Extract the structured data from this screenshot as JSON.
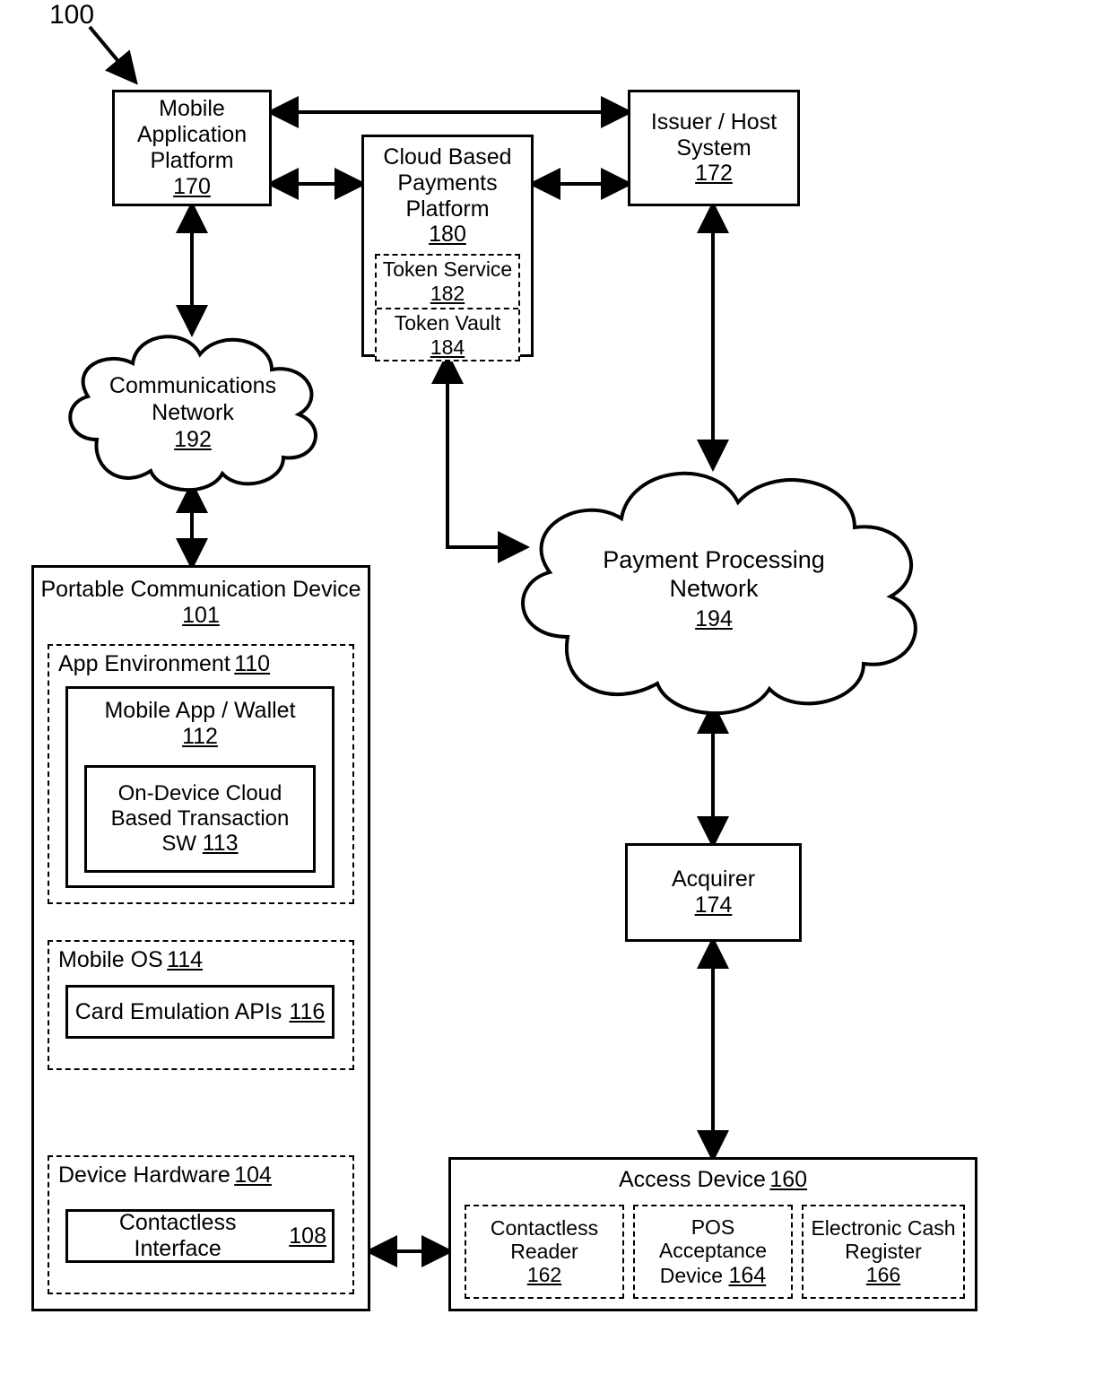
{
  "figure_ref": "100",
  "nodes": {
    "map": {
      "label": "Mobile Application Platform",
      "num": "170"
    },
    "cbpp": {
      "label": "Cloud Based Payments Platform",
      "num": "180"
    },
    "tsvc": {
      "label_a": "Token Service",
      "num_a": "182",
      "label_b": "Token Vault",
      "num_b": "184"
    },
    "issuer": {
      "label": "Issuer / Host System",
      "num": "172"
    },
    "comm": {
      "label": "Communications Network",
      "num": "192"
    },
    "ppn": {
      "label": "Payment Processing Network",
      "num": "194"
    },
    "acq": {
      "label": "Acquirer",
      "num": "174"
    },
    "pcd": {
      "label": "Portable Communication Device",
      "num": "101"
    },
    "appenv": {
      "label": "App Environment",
      "num": "110"
    },
    "wallet": {
      "label": "Mobile App / Wallet",
      "num": "112"
    },
    "odcbt": {
      "label": "On-Device Cloud Based Transaction SW",
      "num": "113"
    },
    "mos": {
      "label": "Mobile OS",
      "num": "114"
    },
    "ceapi": {
      "label": "Card Emulation APIs",
      "num": "116"
    },
    "dhw": {
      "label": "Device Hardware",
      "num": "104"
    },
    "cif": {
      "label": "Contactless Interface",
      "num": "108"
    },
    "adev": {
      "label": "Access Device",
      "num": "160"
    },
    "crdr": {
      "label": "Contactless Reader",
      "num": "162"
    },
    "pos": {
      "label": "POS Acceptance Device",
      "num": "164"
    },
    "ecr": {
      "label": "Electronic Cash Register",
      "num": "166"
    }
  }
}
